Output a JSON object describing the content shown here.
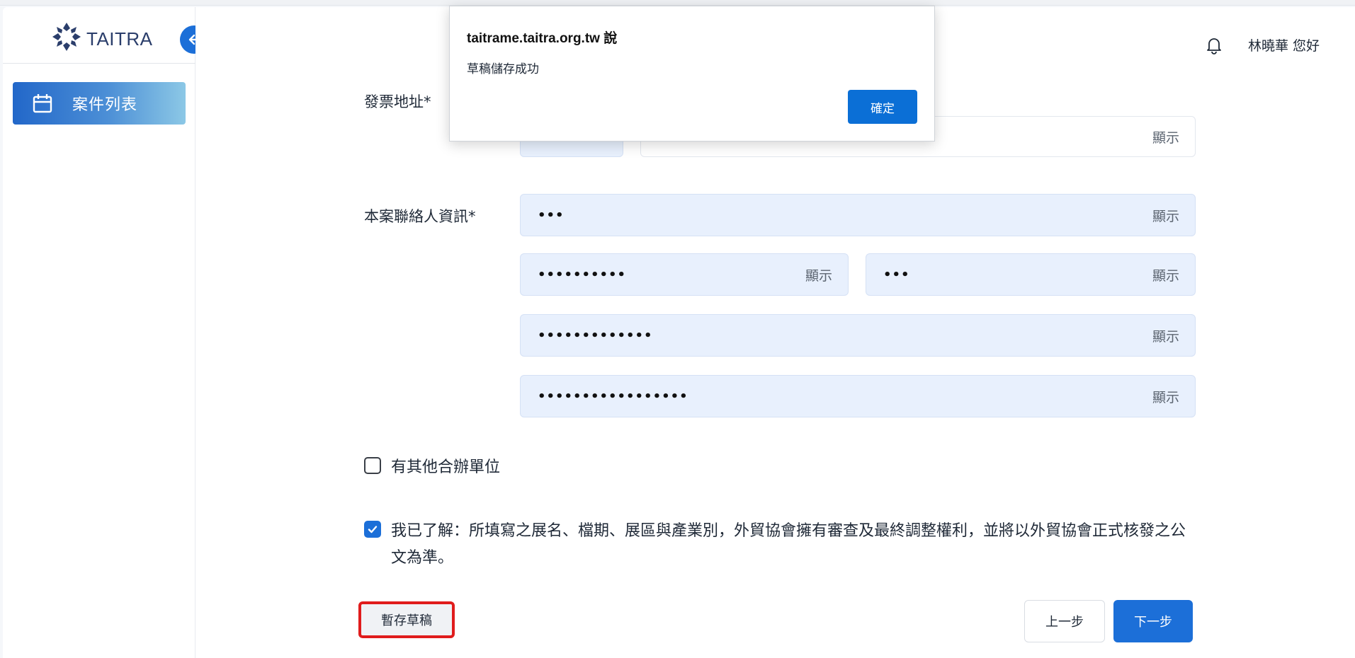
{
  "brand": {
    "logo_text": "TAITRA"
  },
  "sidebar": {
    "items": [
      {
        "label": "案件列表",
        "icon": "calendar-icon"
      }
    ]
  },
  "header": {
    "greeting": "林曉華 您好"
  },
  "form": {
    "invoice_address_label": "發票地址*",
    "contact_label": "本案聯絡人資訊*",
    "show_label": "顯示",
    "fields": [
      {
        "value": "•••"
      },
      {
        "value": "••••••••••"
      },
      {
        "value": "•••"
      },
      {
        "value": "•••••••••••••"
      },
      {
        "value": "•••••••••••••••••"
      }
    ],
    "co_organizer_label": "有其他合辦單位",
    "agreement_text": "我已了解：所填寫之展名、檔期、展區與產業別，外貿協會擁有審查及最終調整權利，並將以外貿協會正式核發之公文為準。",
    "agreement_checked": true,
    "co_organizer_checked": false
  },
  "buttons": {
    "save_draft": "暫存草稿",
    "prev": "上一步",
    "next": "下一步"
  },
  "dialog": {
    "origin": "taitrame.taitra.org.tw 說",
    "message": "草稿儲存成功",
    "ok": "確定"
  },
  "colors": {
    "primary": "#1c6fd8",
    "field_bg": "#e8f0fd",
    "highlight": "#e01c1c"
  }
}
